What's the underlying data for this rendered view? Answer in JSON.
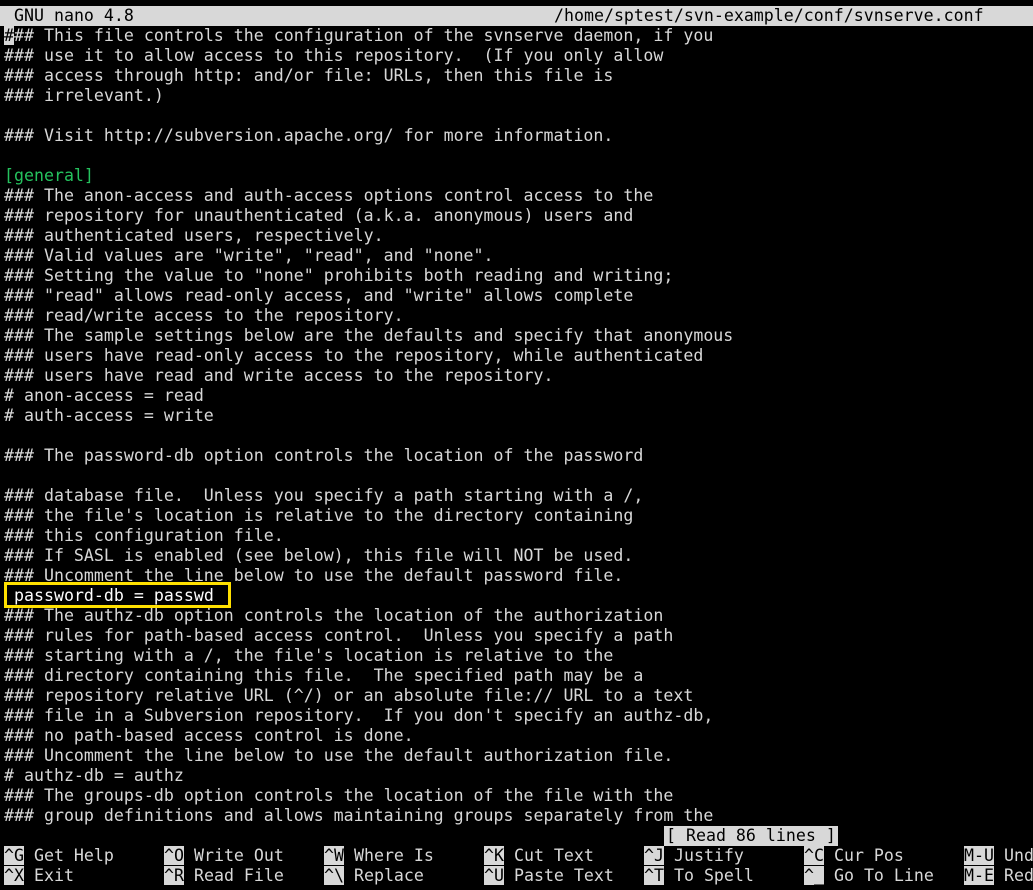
{
  "titlebar": {
    "app": "GNU nano 4.8",
    "path": "/home/sptest/svn-example/conf/svnserve.conf"
  },
  "editor": {
    "lines": [
      "### This file controls the configuration of the svnserve daemon, if you",
      "### use it to allow access to this repository.  (If you only allow",
      "### access through http: and/or file: URLs, then this file is",
      "### irrelevant.)",
      "",
      "### Visit http://subversion.apache.org/ for more information.",
      "",
      "[general]",
      "### The anon-access and auth-access options control access to the",
      "### repository for unauthenticated (a.k.a. anonymous) users and",
      "### authenticated users, respectively.",
      "### Valid values are \"write\", \"read\", and \"none\".",
      "### Setting the value to \"none\" prohibits both reading and writing;",
      "### \"read\" allows read-only access, and \"write\" allows complete",
      "### read/write access to the repository.",
      "### The sample settings below are the defaults and specify that anonymous",
      "### users have read-only access to the repository, while authenticated",
      "### users have read and write access to the repository.",
      "# anon-access = read",
      "# auth-access = write",
      "",
      "### The password-db option controls the location of the password",
      "",
      "### database file.  Unless you specify a path starting with a /,",
      "### the file's location is relative to the directory containing",
      "### this configuration file.",
      "### If SASL is enabled (see below), this file will NOT be used.",
      "### Uncomment the line below to use the default password file.",
      "",
      "### The authz-db option controls the location of the authorization",
      "### rules for path-based access control.  Unless you specify a path",
      "### starting with a /, the file's location is relative to the",
      "### directory containing this file.  The specified path may be a",
      "### repository relative URL (^/) or an absolute file:// URL to a text",
      "### file in a Subversion repository.  If you don't specify an authz-db,",
      "### no path-based access control is done.",
      "### Uncomment the line below to use the default authorization file.",
      "# authz-db = authz",
      "### The groups-db option controls the location of the file with the",
      "### group definitions and allows maintaining groups separately from the"
    ],
    "highlighted_line": "password-db = passwd"
  },
  "status": "[ Read 86 lines ]",
  "shortcuts": [
    {
      "key": "^G",
      "label": "Get Help"
    },
    {
      "key": "^X",
      "label": "Exit"
    },
    {
      "key": "^O",
      "label": "Write Out"
    },
    {
      "key": "^R",
      "label": "Read File"
    },
    {
      "key": "^W",
      "label": "Where Is"
    },
    {
      "key": "^\\",
      "label": "Replace"
    },
    {
      "key": "^K",
      "label": "Cut Text"
    },
    {
      "key": "^U",
      "label": "Paste Text"
    },
    {
      "key": "^J",
      "label": "Justify"
    },
    {
      "key": "^T",
      "label": "To Spell"
    },
    {
      "key": "^C",
      "label": "Cur Pos"
    },
    {
      "key": "^_",
      "label": "Go To Line"
    },
    {
      "key": "M-U",
      "label": "Und"
    },
    {
      "key": "M-E",
      "label": "Red"
    }
  ],
  "colors": {
    "background": "#000000",
    "text": "#d8d8d8",
    "section": "#25c25e",
    "highlight_border": "#ffe000"
  }
}
